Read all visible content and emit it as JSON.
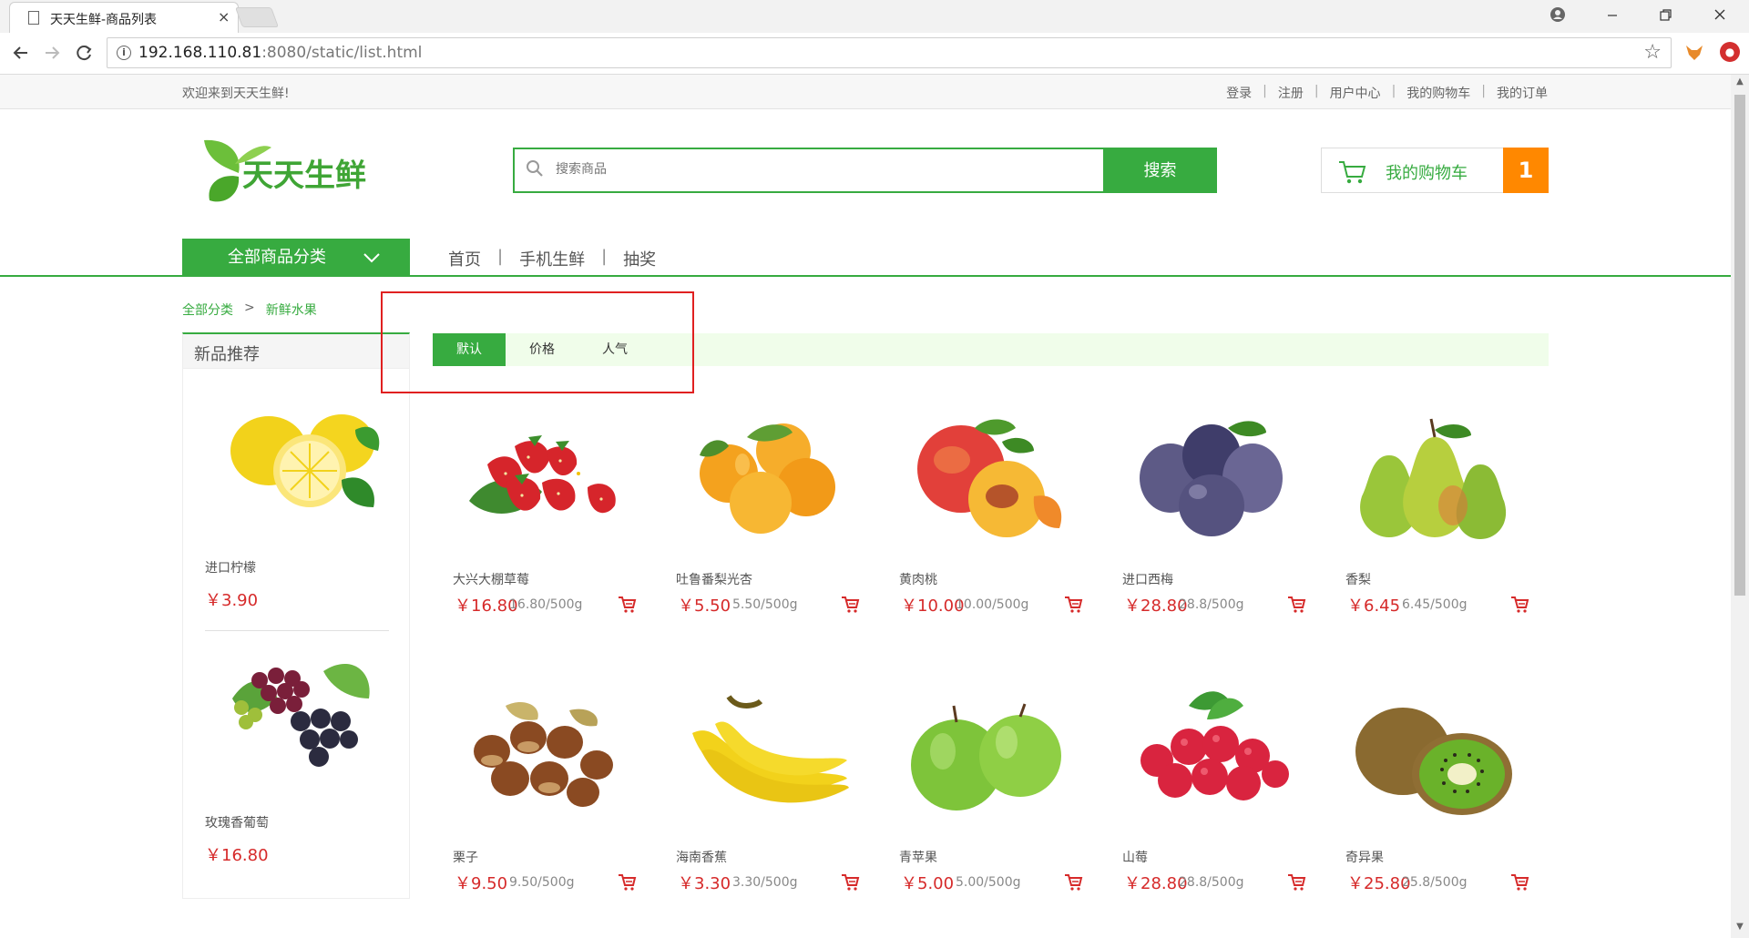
{
  "browser": {
    "tab_title": "天天生鲜-商品列表",
    "tab_close": "×",
    "url_host": "192.168.110.81",
    "url_rest": ":8080/static/list.html"
  },
  "topbar": {
    "welcome": "欢迎来到天天生鲜!",
    "links": [
      "登录",
      "注册",
      "用户中心",
      "我的购物车",
      "我的订单"
    ],
    "sep": "|"
  },
  "header": {
    "logo_text": "天天生鲜",
    "search_placeholder": "搜索商品",
    "search_button": "搜索",
    "cart_label": "我的购物车",
    "cart_count": "1"
  },
  "nav": {
    "all_categories": "全部商品分类",
    "links": [
      "首页",
      "手机生鲜",
      "抽奖"
    ],
    "sep": "|"
  },
  "breadcrumb": {
    "root": "全部分类",
    "arrow": ">",
    "current": "新鲜水果"
  },
  "sidebar": {
    "title": "新品推荐",
    "items": [
      {
        "name": "进口柠檬",
        "price": "￥3.90",
        "image": "lemon-image"
      },
      {
        "name": "玫瑰香葡萄",
        "price": "￥16.80",
        "image": "grape-image"
      }
    ]
  },
  "sort": {
    "options": [
      "默认",
      "价格",
      "人气"
    ],
    "active": "默认"
  },
  "products": [
    {
      "name": "大兴大棚草莓",
      "price": "￥16.80",
      "unit": "16.80/500g",
      "image": "strawberry"
    },
    {
      "name": "吐鲁番梨光杏",
      "price": "￥5.50",
      "unit": "5.50/500g",
      "image": "apricot"
    },
    {
      "name": "黄肉桃",
      "price": "￥10.00",
      "unit": "10.00/500g",
      "image": "peach"
    },
    {
      "name": "进口西梅",
      "price": "￥28.80",
      "unit": "28.8/500g",
      "image": "plum"
    },
    {
      "name": "香梨",
      "price": "￥6.45",
      "unit": "6.45/500g",
      "image": "pear"
    },
    {
      "name": "栗子",
      "price": "￥9.50",
      "unit": "9.50/500g",
      "image": "chestnut"
    },
    {
      "name": "海南香蕉",
      "price": "￥3.30",
      "unit": "3.30/500g",
      "image": "banana"
    },
    {
      "name": "青苹果",
      "price": "￥5.00",
      "unit": "5.00/500g",
      "image": "green-apple"
    },
    {
      "name": "山莓",
      "price": "￥28.80",
      "unit": "28.8/500g",
      "image": "raspberry"
    },
    {
      "name": "奇异果",
      "price": "￥25.80",
      "unit": "25.8/500g",
      "image": "kiwi"
    }
  ],
  "colors": {
    "brand_green": "#37ab40",
    "price_red": "#d62a2a",
    "cart_orange": "#ff8800",
    "highlight_red": "#e02020"
  }
}
